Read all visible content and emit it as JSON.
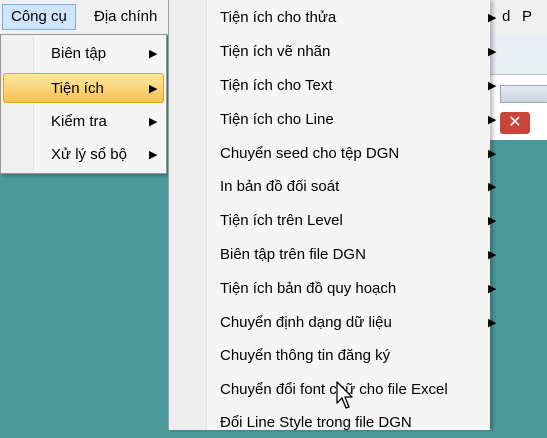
{
  "menubar": {
    "items": [
      {
        "label": "Công cụ"
      },
      {
        "label": "Địa chính"
      },
      {
        "label": "d"
      },
      {
        "label": "P"
      }
    ]
  },
  "right_panel": {
    "close_glyph": "✕"
  },
  "submenu_cong_cu": {
    "items": [
      {
        "label": "Biên tập",
        "arrow": "▶"
      },
      {
        "label": "Tiện ích",
        "arrow": "▶",
        "highlighted": true
      },
      {
        "label": "Kiểm tra",
        "arrow": "▶"
      },
      {
        "label": "Xử lý sổ bộ",
        "arrow": "▶"
      }
    ]
  },
  "submenu_tien_ich": {
    "items": [
      {
        "label": "Tiện ích cho thửa",
        "arrow": "▶"
      },
      {
        "label": "Tiện ích vẽ nhãn",
        "arrow": "▶"
      },
      {
        "label": "Tiện ích cho Text",
        "arrow": "▶"
      },
      {
        "label": "Tiện ích cho Line",
        "arrow": "▶"
      },
      {
        "label": "Chuyển seed cho tệp DGN",
        "arrow": "▶"
      },
      {
        "label": "In bản đồ đối soát",
        "arrow": "▶"
      },
      {
        "label": "Tiện ích trên Level",
        "arrow": "▶"
      },
      {
        "label": "Biên tập trên file DGN",
        "arrow": "▶"
      },
      {
        "label": "Tiện ích bản đồ quy hoạch",
        "arrow": "▶"
      },
      {
        "label": "Chuyển định dạng dữ liệu",
        "arrow": "▶"
      },
      {
        "label": "Chuyển thông tin đăng ký",
        "arrow": ""
      },
      {
        "label": "Chuyển đổi font chữ cho file Excel",
        "arrow": ""
      },
      {
        "label": "Đổi Line Style trong file DGN",
        "arrow": ""
      }
    ]
  },
  "icons": {
    "arrow": "chevron-right-icon",
    "cursor": "mouse-pointer-icon"
  }
}
